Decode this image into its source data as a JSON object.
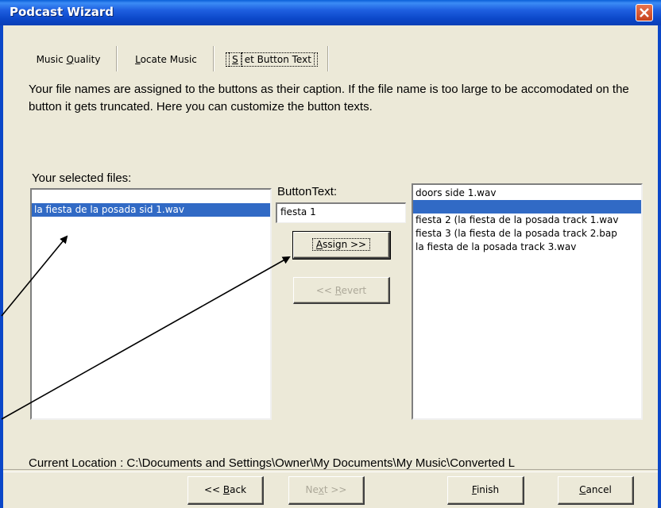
{
  "window": {
    "title": "Podcast Wizard",
    "close_icon": "close-icon"
  },
  "tabs": [
    {
      "pre": "Music ",
      "ul": "Q",
      "post": "uality",
      "active": false
    },
    {
      "pre": "",
      "ul": "L",
      "post": "ocate Music",
      "active": false
    },
    {
      "pre": "",
      "ul": "S",
      "post": "et Button Text",
      "active": true
    }
  ],
  "description": "Your file names are assigned to the buttons as their caption. If the file name is too large to be accomodated on the button it gets truncated. Here you can customize the button texts.",
  "selected_files": {
    "label": "Your selected files:",
    "items": [
      "",
      "la fiesta de la posada sid 1.wav"
    ],
    "selected_index": 1
  },
  "button_text": {
    "label": "ButtonText:",
    "value": "fiesta 1"
  },
  "assign_button": {
    "ul": "A",
    "post": "ssign >>"
  },
  "revert_button": {
    "pre": "<< ",
    "ul": "R",
    "post": "evert"
  },
  "button_list": {
    "items": [
      "doors side 1.wav",
      "",
      "fiesta 2 (la fiesta de la posada track 1.wav",
      "fiesta 3 (la fiesta de la posada track 2.bap",
      "la fiesta de la posada track 3.wav"
    ],
    "selected_index": 1
  },
  "current_location": "Current Location : C:\\Documents and Settings\\Owner\\My Documents\\My Music\\Converted L",
  "footer": {
    "back": {
      "pre": "<< ",
      "ul": "B",
      "post": "ack"
    },
    "next": {
      "pre": "Ne",
      "ul": "x",
      "post": "t >>"
    },
    "finish": {
      "pre": "",
      "ul": "F",
      "post": "inish"
    },
    "cancel": {
      "pre": "",
      "ul": "C",
      "post": "ancel"
    }
  },
  "colors": {
    "titlebar": "#0b47c8",
    "selection": "#316ac5",
    "face": "#ece9d8",
    "close": "#c6411c"
  }
}
